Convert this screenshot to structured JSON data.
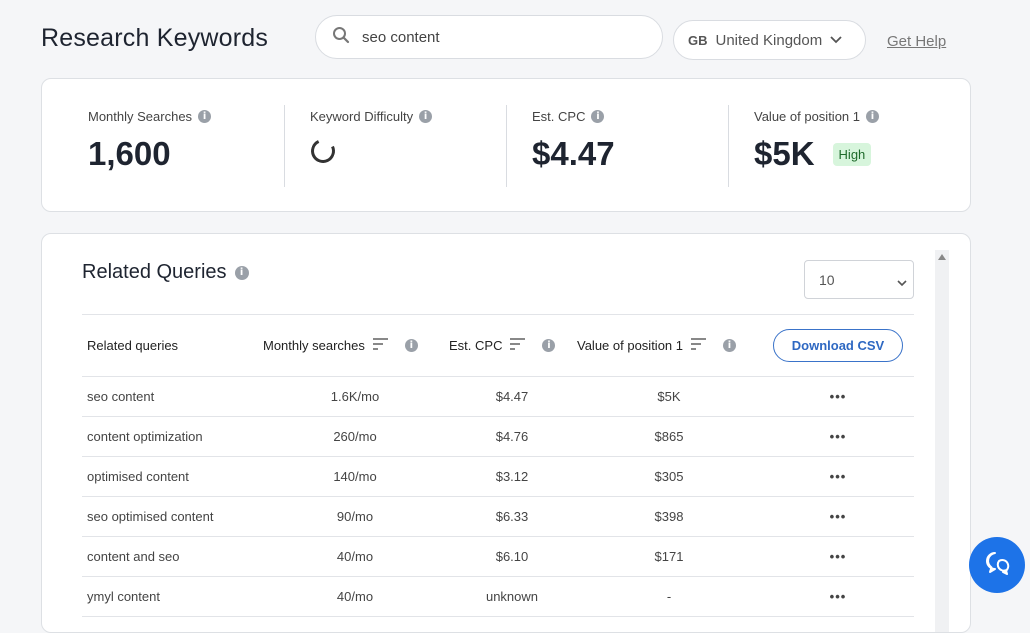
{
  "header": {
    "title": "Research Keywords",
    "search_value": "seo content",
    "country_code": "GB",
    "country_name": "United Kingdom",
    "help_link": "Get Help"
  },
  "stats": [
    {
      "label": "Monthly Searches",
      "value": "1,600"
    },
    {
      "label": "Keyword Difficulty",
      "value": ""
    },
    {
      "label": "Est. CPC",
      "value": "$4.47"
    },
    {
      "label": "Value of position 1",
      "value": "$5K",
      "badge": "High"
    }
  ],
  "related": {
    "title": "Related Queries",
    "page_size": "10",
    "columns": [
      "Related queries",
      "Monthly searches",
      "Est. CPC",
      "Value of position 1"
    ],
    "download_label": "Download CSV",
    "rows": [
      {
        "query": "seo content",
        "searches": "1.6K/mo",
        "cpc": "$4.47",
        "value": "$5K",
        "more": "•••"
      },
      {
        "query": "content optimization",
        "searches": "260/mo",
        "cpc": "$4.76",
        "value": "$865",
        "more": "•••"
      },
      {
        "query": "optimised content",
        "searches": "140/mo",
        "cpc": "$3.12",
        "value": "$305",
        "more": "•••"
      },
      {
        "query": "seo optimised content",
        "searches": "90/mo",
        "cpc": "$6.33",
        "value": "$398",
        "more": "•••"
      },
      {
        "query": "content and seo",
        "searches": "40/mo",
        "cpc": "$6.10",
        "value": "$171",
        "more": "•••"
      },
      {
        "query": "ymyl content",
        "searches": "40/mo",
        "cpc": "unknown",
        "value": "-",
        "more": "•••"
      }
    ]
  },
  "icons": {
    "search": "search-icon",
    "chevron": "chevron-down-icon",
    "info": "info-icon",
    "sort": "sort-icon",
    "chat": "chat-icon"
  },
  "colors": {
    "accent": "#1d73e8",
    "badge_bg": "#d7f5dc",
    "badge_text": "#1f6b2b"
  }
}
